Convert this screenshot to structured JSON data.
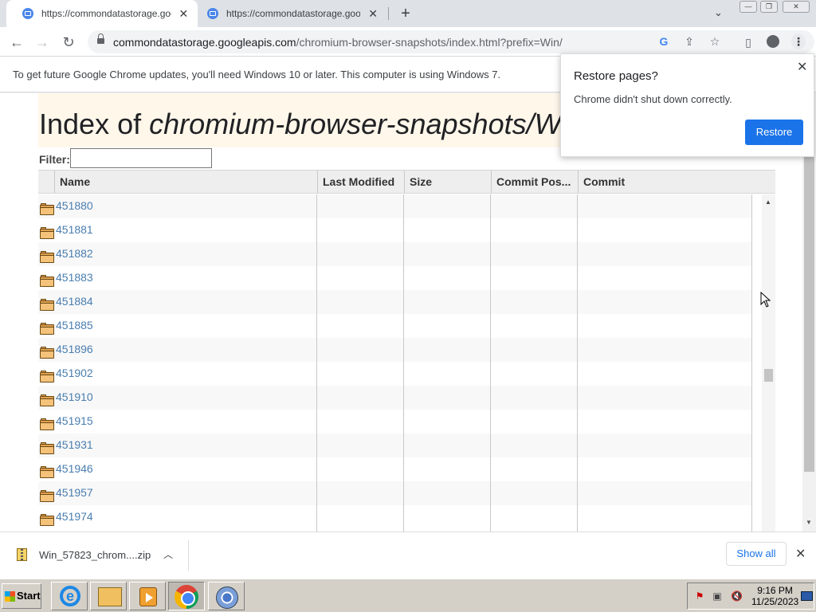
{
  "browser": {
    "tabs": [
      {
        "title": "https://commondatastorage.goo",
        "active": true
      },
      {
        "title": "https://commondatastorage.goo",
        "active": false
      }
    ],
    "address": {
      "host": "commondatastorage.googleapis.com",
      "path": "/chromium-browser-snapshots/index.html?prefix=Win/"
    }
  },
  "infobar": {
    "message": "To get future Google Chrome updates, you'll need Windows 10 or later. This computer is using Windows 7."
  },
  "page": {
    "title_prefix": "Index of ",
    "title_path": "chromium-browser-snapshots/W",
    "filter_label": "Filter:",
    "filter_value": "",
    "columns": [
      "Name",
      "Last Modified",
      "Size",
      "Commit Pos...",
      "Commit"
    ],
    "rows": [
      "451880",
      "451881",
      "451882",
      "451883",
      "451884",
      "451885",
      "451896",
      "451902",
      "451910",
      "451915",
      "451931",
      "451946",
      "451957",
      "451974"
    ]
  },
  "popup": {
    "title": "Restore pages?",
    "message": "Chrome didn't shut down correctly.",
    "button": "Restore"
  },
  "downloads": {
    "file_name": "Win_57823_chrom....zip",
    "show_all": "Show all"
  },
  "taskbar": {
    "start": "Start",
    "time": "9:16 PM",
    "date": "11/25/2023"
  },
  "colors": {
    "accent": "#1a73e8",
    "link": "#4a7eb0",
    "title_bg": "#fff7ea",
    "tabstrip": "#dee1e6"
  }
}
